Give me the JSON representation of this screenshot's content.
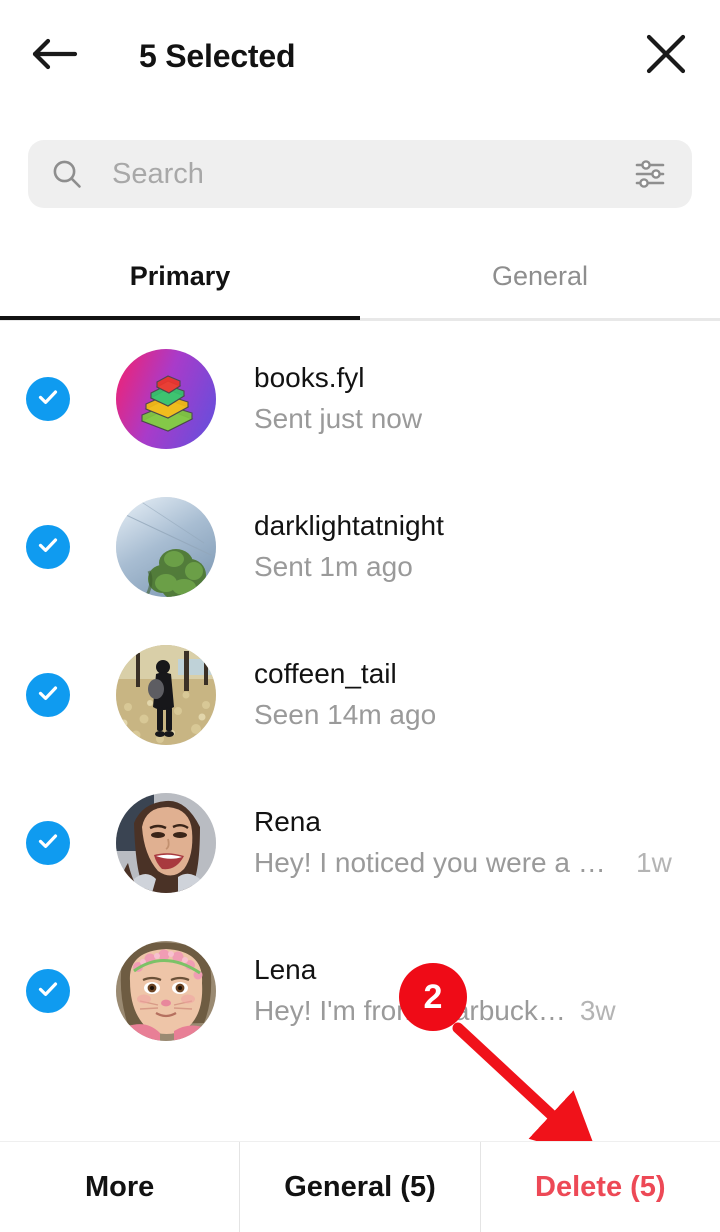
{
  "header": {
    "title": "5 Selected",
    "back_icon": "arrow-left-icon",
    "close_icon": "close-x-icon"
  },
  "search": {
    "placeholder": "Search",
    "value": "",
    "search_icon": "search-icon",
    "filter_icon": "filter-sliders-icon"
  },
  "tabs": [
    {
      "label": "Primary",
      "active": true
    },
    {
      "label": "General",
      "active": false
    }
  ],
  "conversations": [
    {
      "name": "books.fyl",
      "preview": "Sent just now",
      "time": "",
      "selected": true,
      "avatar": "books-gradient-avatar"
    },
    {
      "name": "darklightatnight",
      "preview": "Sent 1m ago",
      "time": "",
      "selected": true,
      "avatar": "sky-tree-photo-avatar"
    },
    {
      "name": "coffeen_tail",
      "preview": "Seen 14m ago",
      "time": "",
      "selected": true,
      "avatar": "person-autumn-leaves-avatar"
    },
    {
      "name": "Rena",
      "preview": "Hey! I noticed you were a S…",
      "time": "1w",
      "selected": true,
      "avatar": "smiling-woman-avatar"
    },
    {
      "name": "Lena",
      "preview": "Hey! I'm from Starbuck…",
      "time": "3w",
      "selected": true,
      "avatar": "flower-crown-woman-avatar"
    }
  ],
  "annotation": {
    "step_number": "2",
    "color": "#ef0b17"
  },
  "bottom_bar": {
    "more_label": "More",
    "general_label": "General (5)",
    "delete_label": "Delete (5)",
    "delete_color": "#ed4956"
  },
  "colors": {
    "selected_check": "#0f9bf0",
    "search_background": "#efefef",
    "primary_text": "#121212",
    "secondary_text": "#9a9a9a"
  }
}
